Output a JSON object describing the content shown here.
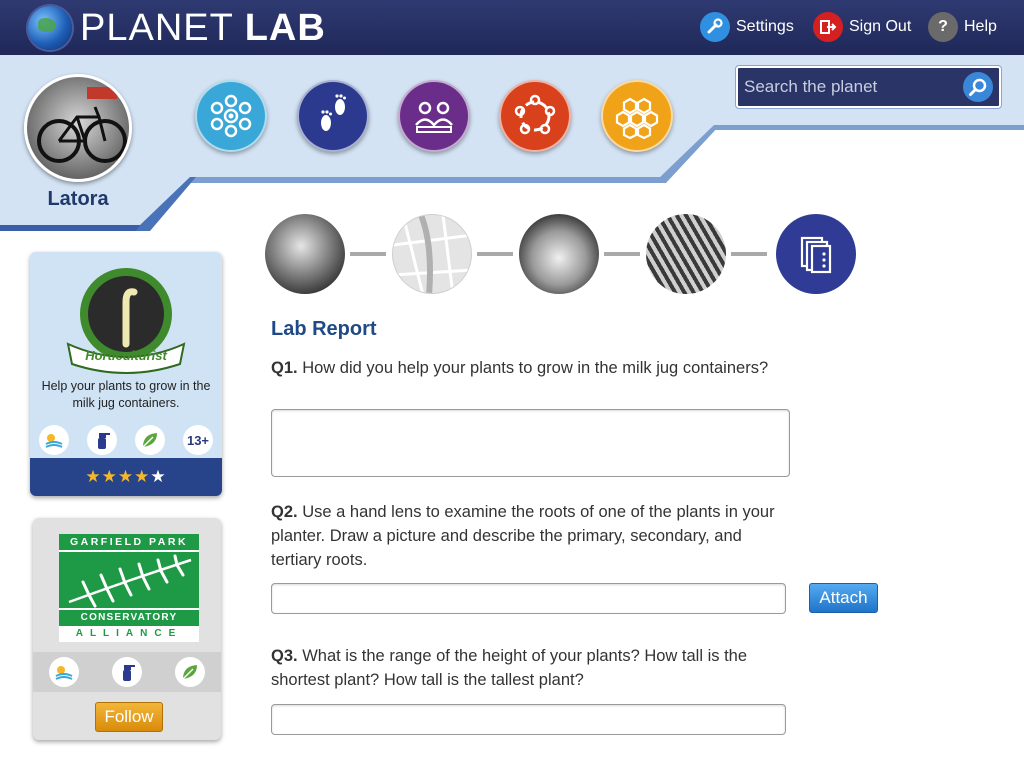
{
  "header": {
    "logo_light": "PLANET",
    "logo_bold": "LAB",
    "settings_label": "Settings",
    "signout_label": "Sign Out",
    "help_label": "Help",
    "help_glyph": "?"
  },
  "search": {
    "placeholder": "Search the planet"
  },
  "user": {
    "name": "Latora"
  },
  "categories": [
    {
      "name": "observe-icon",
      "color": "#3aa7d9"
    },
    {
      "name": "footprints-icon",
      "color": "#2b3a8f"
    },
    {
      "name": "people-icon",
      "color": "#6a2d8a"
    },
    {
      "name": "molecule-icon",
      "color": "#d8411c"
    },
    {
      "name": "hexagon-icon",
      "color": "#f0a319"
    }
  ],
  "mission_card": {
    "badge_label": "Horticulturist",
    "description": "Help your plants to grow in the milk jug containers.",
    "age_label": "13+",
    "rating": 4,
    "stars_filled": "★★★★",
    "stars_empty": "★"
  },
  "partner_card": {
    "logo_top": "GARFIELD PARK",
    "logo_bottom": "CONSERVATORY",
    "logo_tail": "ALLIANCE",
    "follow_label": "Follow"
  },
  "lab_report": {
    "title": "Lab Report",
    "questions": [
      {
        "number": "Q1.",
        "text": "How did you help your plants to grow in the milk jug containers?"
      },
      {
        "number": "Q2.",
        "text": "Use a hand lens to examine the roots of one of the plants in your planter. Draw a picture and describe the primary, secondary, and tertiary roots."
      },
      {
        "number": "Q3.",
        "text": "What is the range of the height of your plants? How tall is the shortest plant? How tall is the tallest plant?"
      }
    ],
    "attach_label": "Attach"
  },
  "colors": {
    "header_bg": "#24306a",
    "banner_light": "#d3e3f4",
    "accent_blue": "#1f4a86"
  }
}
